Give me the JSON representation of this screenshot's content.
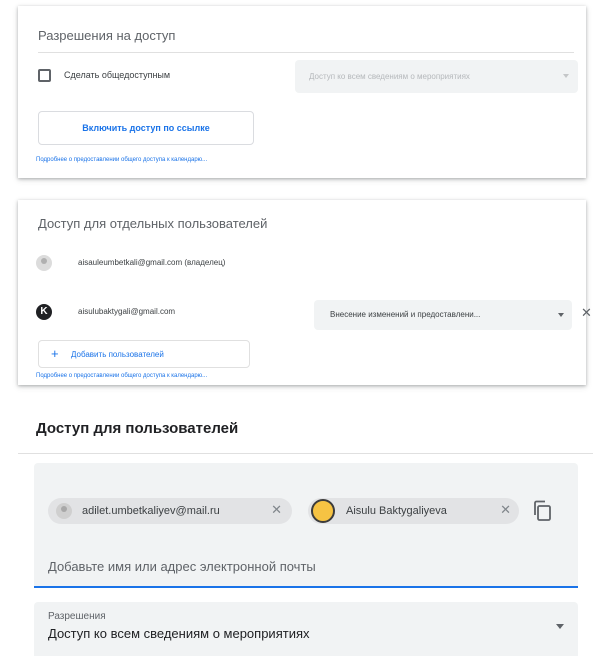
{
  "public_access": {
    "heading": "Разрешения на доступ",
    "checkbox_label": "Сделать общедоступным",
    "checkbox_checked": false,
    "permission_select": "Доступ ко всем сведениям о мероприятиях",
    "link_button": "Включить доступ по ссылке",
    "more_link": "Подробнее о предоставлении общего доступа к календарю..."
  },
  "specific_users": {
    "heading": "Доступ для отдельных пользователей",
    "users": [
      {
        "email": "aisauleumbetkali@gmail.com (владелец)"
      },
      {
        "email": "aisulubaktygali@gmail.com",
        "avatar_letter": "K",
        "permission": "Внесение изменений и предоставлени..."
      }
    ],
    "add_button": "Добавить пользователей",
    "more_link": "Подробнее о предоставлении общего доступа к календарю..."
  },
  "user_access": {
    "heading": "Доступ для пользователей",
    "chips": [
      {
        "label": "adilet.umbetkaliyev@mail.ru"
      },
      {
        "label": "Aisulu Baktygaliyeva"
      }
    ],
    "input_placeholder": "Добавьте имя или адрес электронной почты",
    "permissions_label": "Разрешения",
    "permissions_value": "Доступ ко всем сведениям о мероприятиях"
  },
  "colors": {
    "accent": "#1a73e8",
    "field_bg": "#f1f3f4",
    "text": "#3c4043"
  }
}
